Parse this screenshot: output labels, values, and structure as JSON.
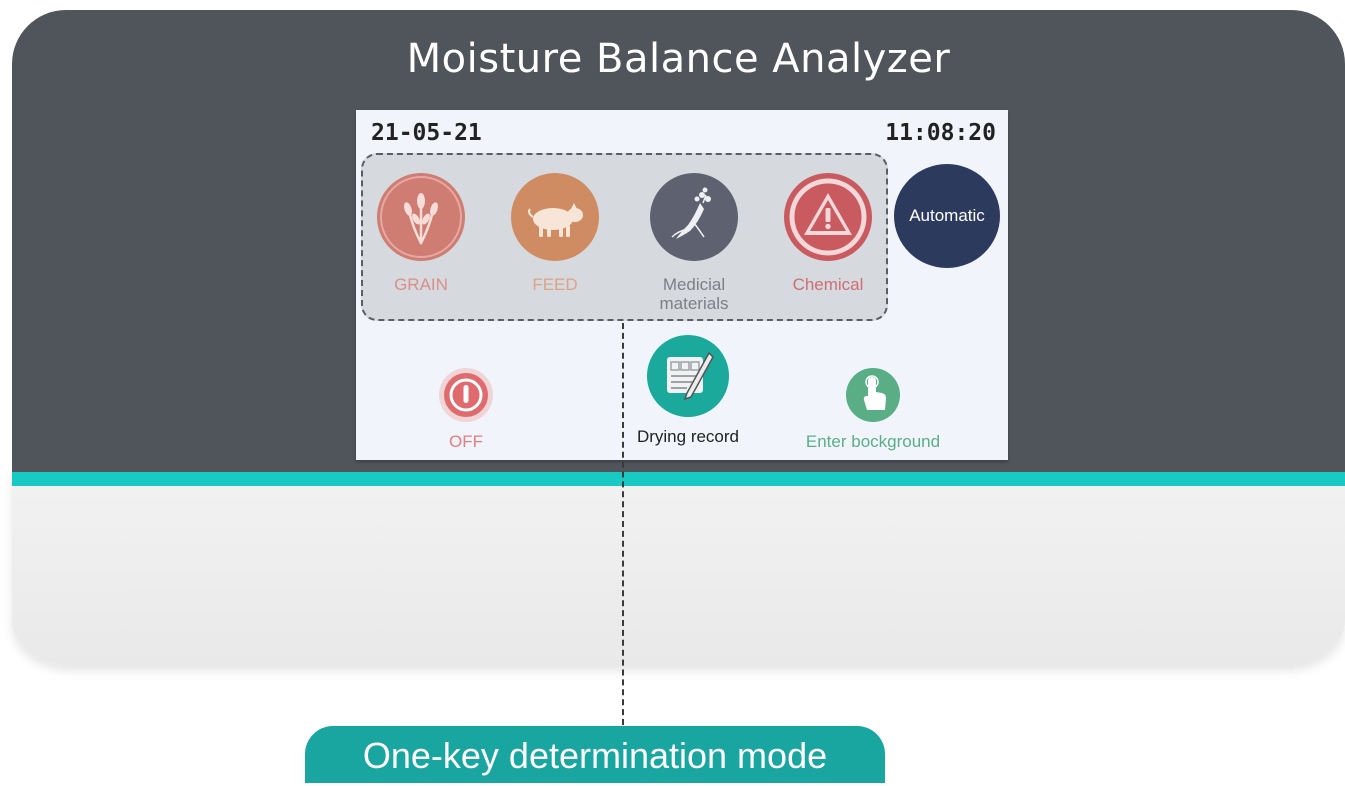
{
  "title": "Moisture Balance Analyzer",
  "screen": {
    "date": "21-05-21",
    "time": "11:08:20",
    "modes": [
      {
        "label": "GRAIN",
        "icon": "wheat-icon",
        "color": "#cf7c73",
        "label_color": "#d9908a"
      },
      {
        "label": "FEED",
        "icon": "pig-icon",
        "color": "#cf8c63",
        "label_color": "#dba488"
      },
      {
        "label": "Medicial materials",
        "icon": "ginseng-icon",
        "color": "#5e6270",
        "label_color": "#7c7f86"
      },
      {
        "label": "Chemical",
        "icon": "warning-icon",
        "color": "#c85a60",
        "label_color": "#cf6e74"
      }
    ],
    "automatic_label": "Automatic",
    "off_label": "OFF",
    "drying_record_label": "Drying record",
    "enter_background_label": "Enter bockground"
  },
  "callout": "One-key determination mode",
  "colors": {
    "device": "#50555b",
    "teal": "#19c9c3",
    "automatic": "#2c3a5e",
    "off": "#df6b6e",
    "record": "#1aa99b",
    "background_button": "#5aae86"
  }
}
